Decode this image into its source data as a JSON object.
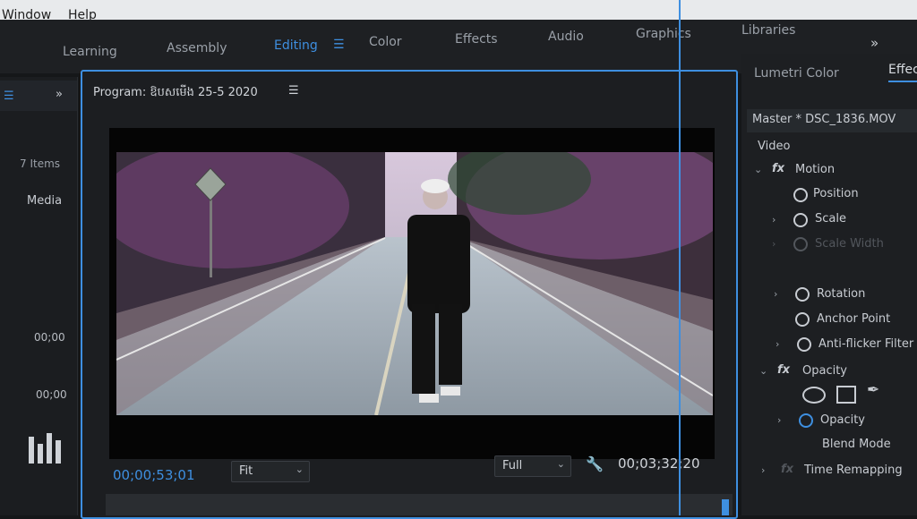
{
  "menu": {
    "items": [
      "Window",
      "Help"
    ]
  },
  "workspaces": {
    "tabs": [
      "Learning",
      "Assembly",
      "Editing",
      "Color",
      "Effects",
      "Audio",
      "Graphics",
      "Libraries"
    ],
    "active": "Editing"
  },
  "left_panel": {
    "items_count": "7 Items",
    "media_tab": "Media",
    "timecodes": [
      "00;00",
      "00;00"
    ]
  },
  "program": {
    "title": "Program: ឱបសមើង 25-5 2020",
    "current_timecode": "00;00;53;01",
    "fit_label": "Fit",
    "quality_label": "Full",
    "duration_timecode": "00;03;32;20"
  },
  "effect_controls": {
    "tabs": [
      "Lumetri Color",
      "Effec"
    ],
    "clip": "Master * DSC_1836.MOV",
    "section": "Video",
    "motion": "Motion",
    "position": "Position",
    "scale": "Scale",
    "scale_width": "Scale Width",
    "rotation": "Rotation",
    "anchor_point": "Anchor Point",
    "anti_flicker": "Anti-flicker Filter",
    "opacity_group": "Opacity",
    "opacity": "Opacity",
    "blend_mode": "Blend Mode",
    "time_remapping": "Time Remapping"
  },
  "colors": {
    "accent": "#3e8fe0",
    "panel": "#1d1f22"
  }
}
